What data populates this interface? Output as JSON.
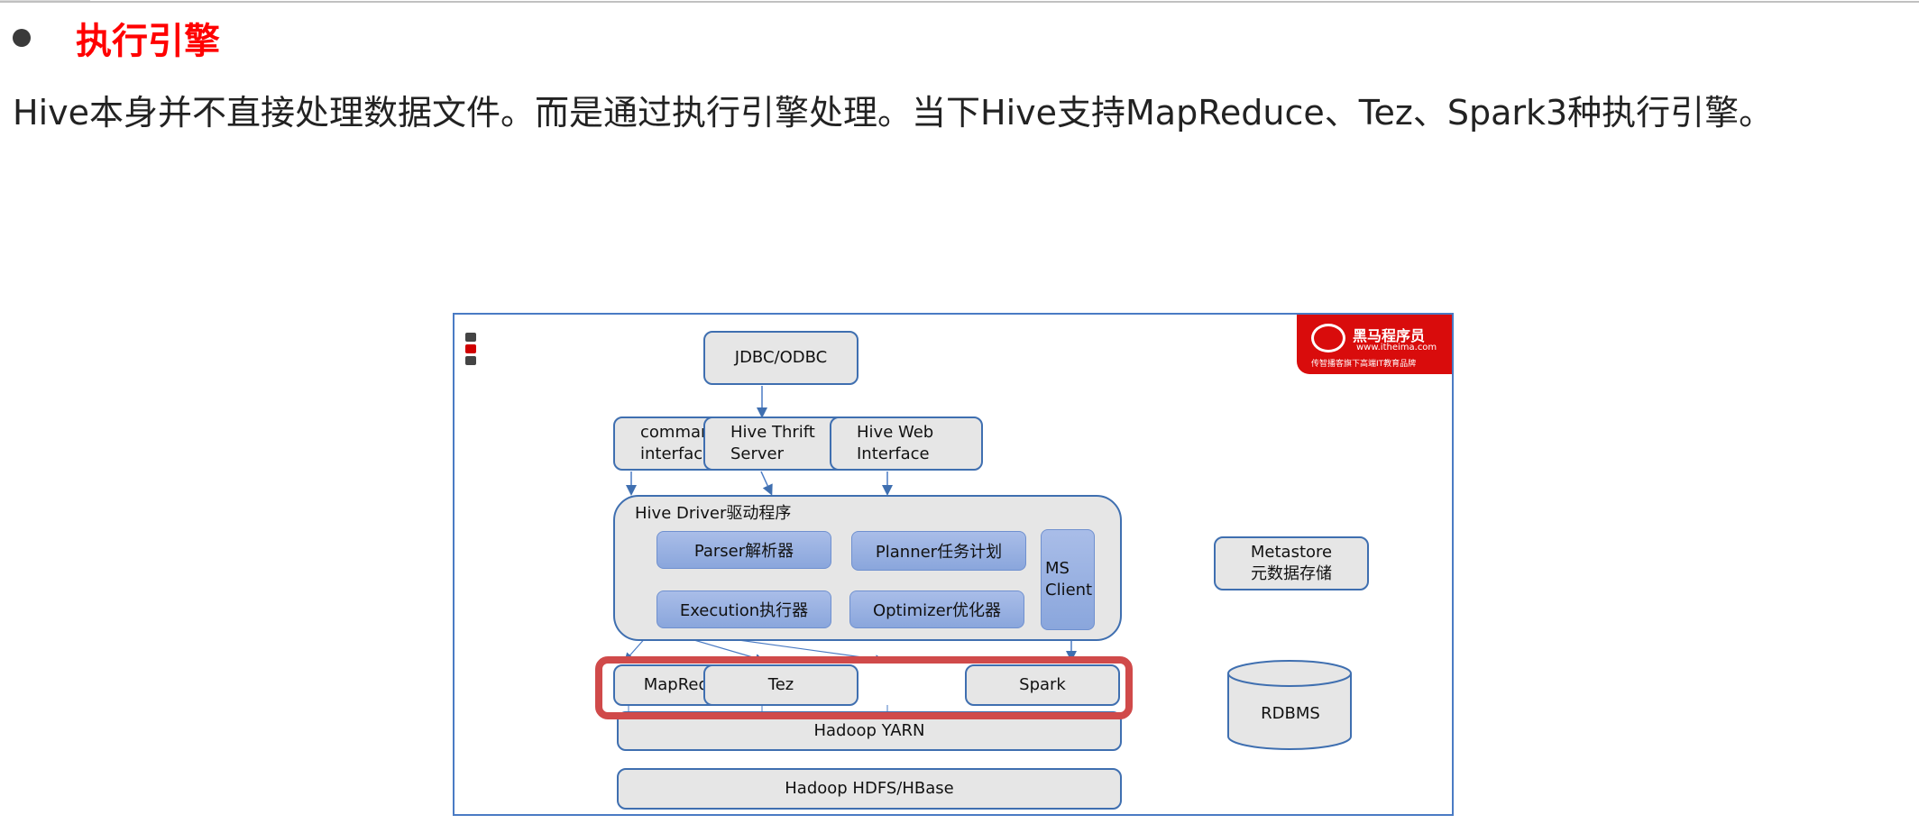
{
  "heading": {
    "text": "执行引擎",
    "color": "#ff0000"
  },
  "paragraph": "Hive本身并不直接处理数据文件。而是通过执行引擎处理。当下Hive支持MapReduce、Tez、Spark3种执行引擎。",
  "diagram": {
    "logo": {
      "brand": "黑马程序员",
      "url": "www.itheima.com",
      "slogan": "传智播客旗下高端IT教育品牌"
    },
    "jdbc": "JDBC/ODBC",
    "cli": [
      "command-line",
      "interface"
    ],
    "thrift": [
      "Hive Thrift",
      "Server"
    ],
    "web": [
      "Hive Web",
      "Interface"
    ],
    "driver": {
      "title": "Hive Driver驱动程序",
      "parser": "Parser解析器",
      "planner": "Planner任务计划",
      "execution": "Execution执行器",
      "optimizer": "Optimizer优化器",
      "ms_client": [
        "MS",
        "Client"
      ]
    },
    "metastore": [
      "Metastore",
      "元数据存储"
    ],
    "engines": [
      "MapReduce",
      "Tez",
      "Spark"
    ],
    "rdbms": "RDBMS",
    "yarn": "Hadoop YARN",
    "hdfs": "Hadoop HDFS/HBase",
    "highlight_color": "#d04a4a"
  }
}
